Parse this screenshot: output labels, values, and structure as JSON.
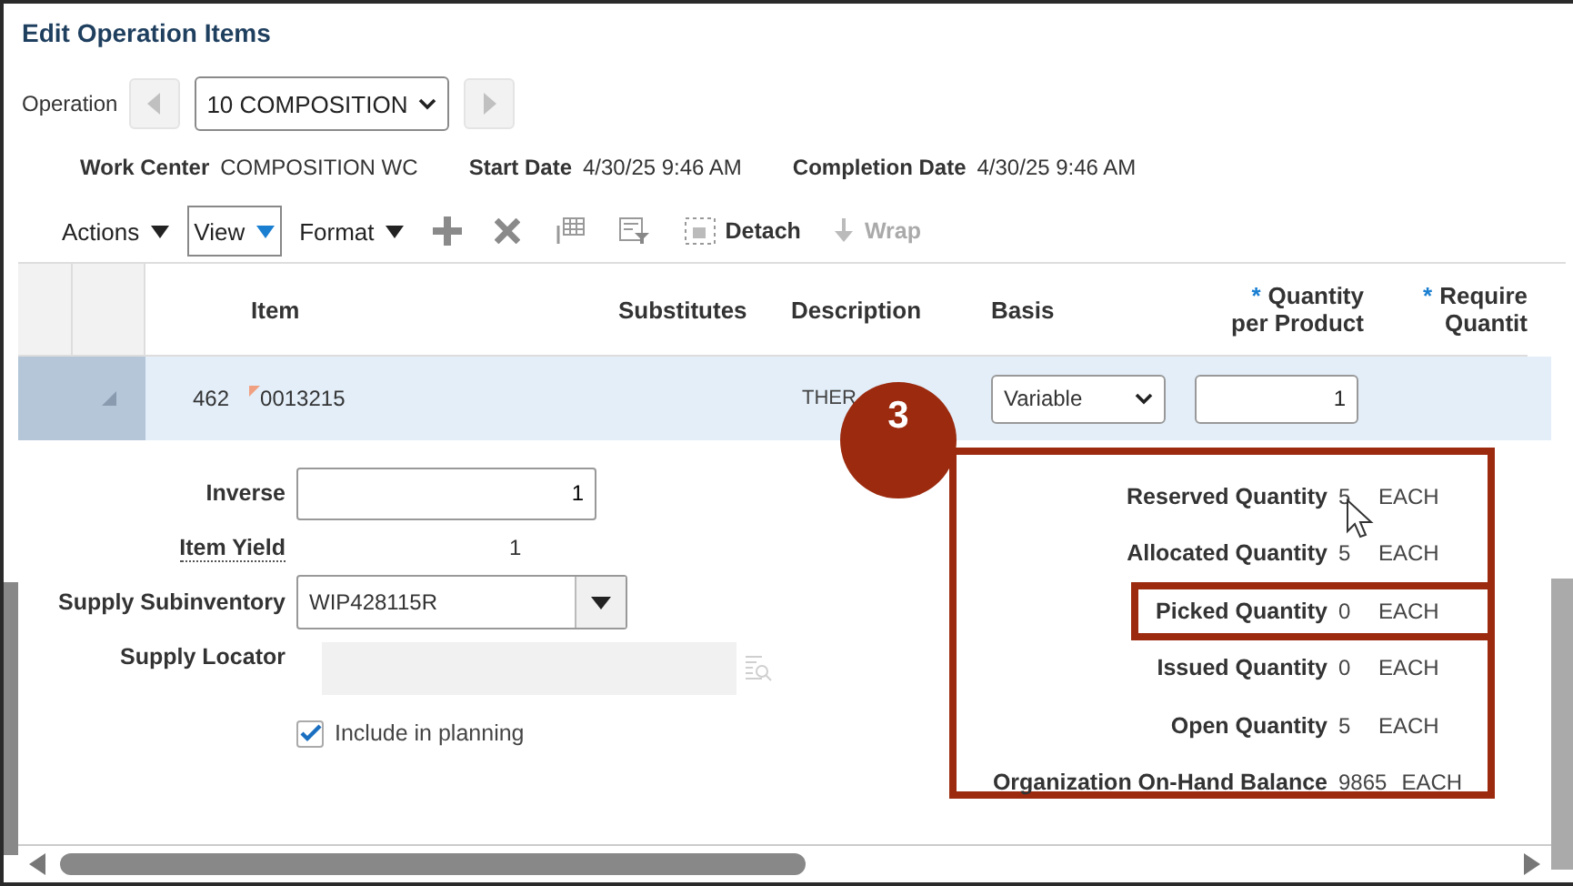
{
  "title": "Edit Operation Items",
  "operation": {
    "label": "Operation",
    "value": "10 COMPOSITION",
    "previous": {
      "disabled": true
    },
    "next": {
      "disabled": true
    }
  },
  "info": [
    {
      "label": "Work Center",
      "value": "COMPOSITION WC"
    },
    {
      "label": "Start Date",
      "value": "4/30/25 9:46 AM"
    },
    {
      "label": "Completion Date",
      "value": "4/30/25 9:46 AM"
    }
  ],
  "toolbar": [
    {
      "kind": "menu",
      "label": "Actions",
      "selected": false
    },
    {
      "kind": "menu",
      "label": "View",
      "selected": true
    },
    {
      "kind": "menu",
      "label": "Format",
      "selected": false
    },
    {
      "kind": "add",
      "disabled": false
    },
    {
      "kind": "delete",
      "disabled": false
    },
    {
      "kind": "freeze",
      "disabled": false
    },
    {
      "kind": "filter",
      "disabled": false
    },
    {
      "kind": "detach",
      "label": "Detach",
      "disabled": false
    },
    {
      "kind": "wrap",
      "label": "Wrap",
      "disabled": true
    }
  ],
  "table": {
    "columns": [
      {
        "label": "Item"
      },
      {
        "label": "Substitutes"
      },
      {
        "label": "Description"
      },
      {
        "label": "Basis"
      },
      {
        "label": "Quantity",
        "label_2": "per Product",
        "marker": "*"
      },
      {
        "label": "Require",
        "label_2": "Quantit",
        "marker": "*"
      }
    ],
    "rows": [
      {
        "selected": true,
        "line": "462",
        "item": "0013215",
        "description": "THER",
        "basis": "Variable",
        "quantity_per_product": "1"
      }
    ]
  },
  "details": {
    "inverse": {
      "label": "Inverse",
      "value": "1"
    },
    "item_yield": {
      "label": "Item Yield",
      "value": "1"
    },
    "supply_subinventory": {
      "label": "Supply Subinventory",
      "value": "WIP428115R"
    },
    "supply_locator": {
      "label": "Supply Locator",
      "disabled": true
    },
    "include_in_planning": {
      "label": "Include in planning",
      "checked": true
    }
  },
  "quantities": [
    {
      "label": "Reserved Quantity",
      "value": "5",
      "unit": "EACH",
      "highlighted": false
    },
    {
      "label": "Allocated Quantity",
      "value": "5",
      "unit": "EACH",
      "highlighted": false
    },
    {
      "label": "Picked Quantity",
      "value": "0",
      "unit": "EACH",
      "highlighted": true
    },
    {
      "label": "Issued Quantity",
      "value": "0",
      "unit": "EACH",
      "highlighted": false
    },
    {
      "label": "Open Quantity",
      "value": "5",
      "unit": "EACH",
      "highlighted": false
    },
    {
      "label": "Organization On-Hand Balance",
      "value": "9865",
      "unit": "EACH",
      "highlighted": false
    }
  ],
  "callout": {
    "step": "3"
  }
}
